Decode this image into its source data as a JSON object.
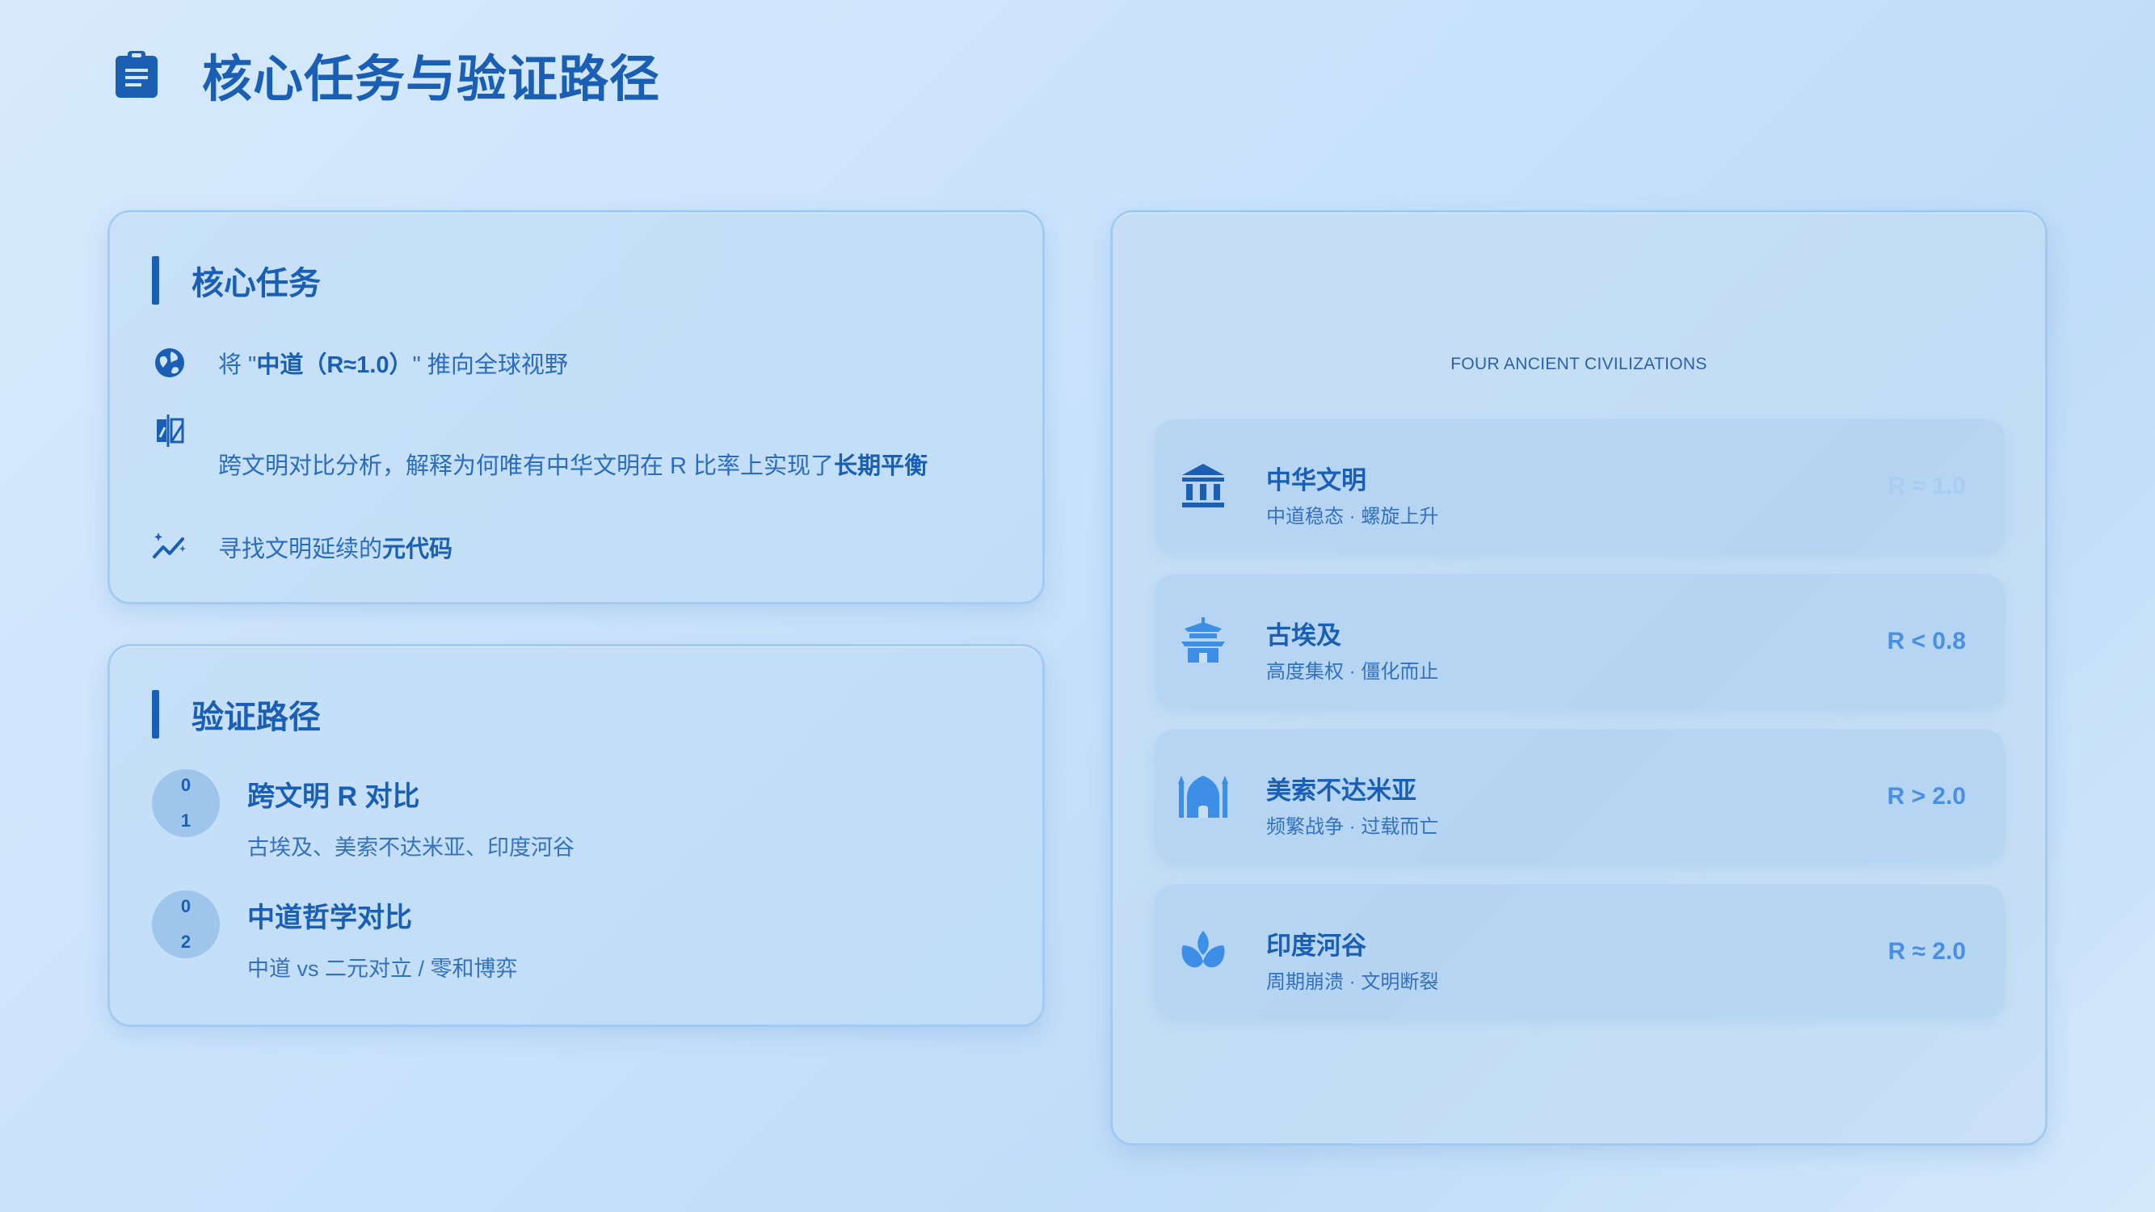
{
  "header": {
    "title": "核心任务与验证路径"
  },
  "core_task": {
    "title": "核心任务",
    "items": [
      {
        "icon": "globe-icon",
        "prefix": "将 \"",
        "bold": "中道（R≈1.0）",
        "suffix": "\" 推向全球视野"
      },
      {
        "icon": "compare-icon",
        "prefix": "跨文明对比分析，解释为何唯有中华文明在 R 比率上实现了",
        "bold": "长期平衡",
        "suffix": ""
      },
      {
        "icon": "sparkle-chart-icon",
        "prefix": "寻找文明延续的",
        "bold": "元代码",
        "suffix": ""
      }
    ]
  },
  "verify_path": {
    "title": "验证路径",
    "steps": [
      {
        "num_top": "0",
        "num_bottom": "1",
        "title": "跨文明 R 对比",
        "desc": "古埃及、美索不达米亚、印度河谷"
      },
      {
        "num_top": "0",
        "num_bottom": "2",
        "title": "中道哲学对比",
        "desc": "中道 vs 二元对立 / 零和博弈"
      }
    ]
  },
  "civilizations": {
    "heading": "FOUR ANCIENT CIVILIZATIONS",
    "items": [
      {
        "icon": "museum-icon",
        "name": "中华文明",
        "desc": "中道稳态 · 螺旋上升",
        "ratio": "R ≈ 1.0",
        "icon_color": "#1a5fb4",
        "ratio_color": "#a7cdf2"
      },
      {
        "icon": "temple-icon",
        "name": "古埃及",
        "desc": "高度集权 · 僵化而止",
        "ratio": "R < 0.8",
        "icon_color": "#3d8ee6",
        "ratio_color": "#4a90e2"
      },
      {
        "icon": "mosque-icon",
        "name": "美索不达米亚",
        "desc": "频繁战争 · 过载而亡",
        "ratio": "R > 2.0",
        "icon_color": "#3d8ee6",
        "ratio_color": "#4a90e2"
      },
      {
        "icon": "lotus-icon",
        "name": "印度河谷",
        "desc": "周期崩溃 · 文明断裂",
        "ratio": "R ≈ 2.0",
        "icon_color": "#3d8ee6",
        "ratio_color": "#4a90e2"
      }
    ]
  },
  "colors": {
    "primary": "#1a5fb4",
    "accent": "#3d8ee6",
    "background": "#cfe5fb"
  }
}
